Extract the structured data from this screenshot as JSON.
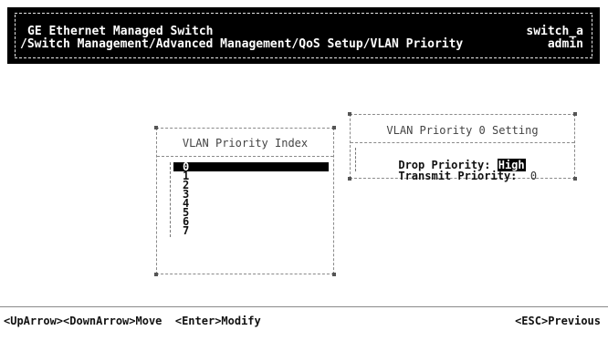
{
  "header": {
    "title": "GE Ethernet Managed Switch",
    "path": "/Switch Management/Advanced Management/QoS Setup/VLAN Priority",
    "device": "switch_a",
    "user": "admin"
  },
  "index_panel": {
    "title": "VLAN Priority Index",
    "items": [
      "0",
      "1",
      "2",
      "3",
      "4",
      "5",
      "6",
      "7"
    ],
    "selected": "0"
  },
  "setting_panel": {
    "title": "VLAN Priority 0 Setting",
    "drop_label": "Drop Priority: ",
    "drop_value": "High",
    "transmit_label": "Transmit Priority:  ",
    "transmit_value": "0"
  },
  "help": {
    "left": "<UpArrow><DownArrow>Move  <Enter>Modify",
    "right": "<ESC>Previous"
  }
}
